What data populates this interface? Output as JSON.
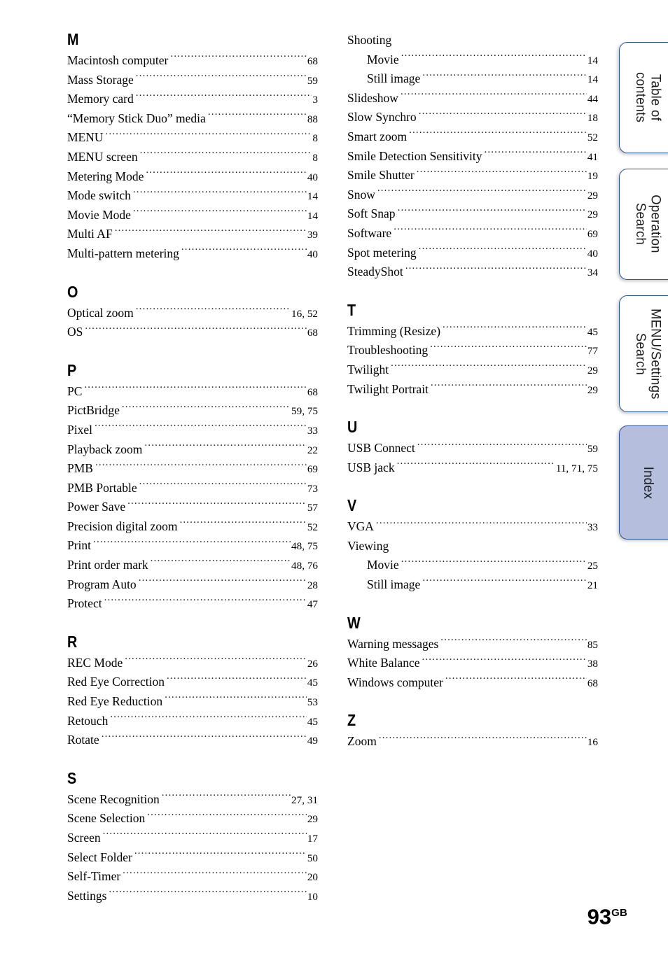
{
  "document": {
    "page_number": "93",
    "page_number_suffix": "GB"
  },
  "side_tabs": [
    {
      "label": "Table of\ncontents",
      "active": false
    },
    {
      "label": "Operation\nSearch",
      "active": false
    },
    {
      "label": "MENU/Settings\nSearch",
      "active": false
    },
    {
      "label": "Index",
      "active": true
    }
  ],
  "columns": [
    {
      "blocks": [
        {
          "letter": "M",
          "entries": [
            {
              "label": "Macintosh computer",
              "page": "68"
            },
            {
              "label": "Mass Storage",
              "page": "59"
            },
            {
              "label": "Memory card",
              "page": "3"
            },
            {
              "label": "“Memory Stick Duo” media",
              "page": "88"
            },
            {
              "label": "MENU",
              "page": "8"
            },
            {
              "label": "MENU screen",
              "page": "8"
            },
            {
              "label": "Metering Mode",
              "page": "40"
            },
            {
              "label": "Mode switch",
              "page": "14"
            },
            {
              "label": "Movie Mode",
              "page": "14"
            },
            {
              "label": "Multi AF",
              "page": "39"
            },
            {
              "label": "Multi-pattern metering",
              "page": "40"
            }
          ]
        },
        {
          "letter": "O",
          "entries": [
            {
              "label": "Optical zoom",
              "page": "16, 52"
            },
            {
              "label": "OS",
              "page": "68"
            }
          ]
        },
        {
          "letter": "P",
          "entries": [
            {
              "label": "PC",
              "page": "68"
            },
            {
              "label": "PictBridge",
              "page": "59, 75"
            },
            {
              "label": "Pixel",
              "page": "33"
            },
            {
              "label": "Playback zoom",
              "page": "22"
            },
            {
              "label": "PMB",
              "page": "69"
            },
            {
              "label": "PMB Portable",
              "page": "73"
            },
            {
              "label": "Power Save",
              "page": "57"
            },
            {
              "label": "Precision digital zoom",
              "page": "52"
            },
            {
              "label": "Print",
              "page": "48, 75"
            },
            {
              "label": "Print order mark",
              "page": "48, 76"
            },
            {
              "label": "Program Auto",
              "page": "28"
            },
            {
              "label": "Protect",
              "page": "47"
            }
          ]
        },
        {
          "letter": "R",
          "entries": [
            {
              "label": "REC Mode",
              "page": "26"
            },
            {
              "label": "Red Eye Correction",
              "page": "45"
            },
            {
              "label": "Red Eye Reduction",
              "page": "53"
            },
            {
              "label": "Retouch",
              "page": "45"
            },
            {
              "label": "Rotate",
              "page": "49"
            }
          ]
        },
        {
          "letter": "S",
          "entries": [
            {
              "label": "Scene Recognition",
              "page": "27, 31"
            },
            {
              "label": "Scene Selection",
              "page": "29"
            },
            {
              "label": "Screen",
              "page": "17"
            },
            {
              "label": "Select Folder",
              "page": "50"
            },
            {
              "label": "Self-Timer",
              "page": "20"
            },
            {
              "label": "Settings",
              "page": "10"
            }
          ]
        }
      ]
    },
    {
      "blocks": [
        {
          "letter": "",
          "entries": [
            {
              "label": "Shooting",
              "page": ""
            },
            {
              "label": "Movie",
              "page": "14",
              "sub": true
            },
            {
              "label": "Still image",
              "page": "14",
              "sub": true
            },
            {
              "label": "Slideshow",
              "page": "44"
            },
            {
              "label": "Slow Synchro",
              "page": "18"
            },
            {
              "label": "Smart zoom",
              "page": "52"
            },
            {
              "label": "Smile Detection Sensitivity",
              "page": "41"
            },
            {
              "label": "Smile Shutter",
              "page": "19"
            },
            {
              "label": "Snow",
              "page": "29"
            },
            {
              "label": "Soft Snap",
              "page": "29"
            },
            {
              "label": "Software",
              "page": "69"
            },
            {
              "label": "Spot metering",
              "page": "40"
            },
            {
              "label": "SteadyShot",
              "page": "34"
            }
          ]
        },
        {
          "letter": "T",
          "entries": [
            {
              "label": "Trimming (Resize)",
              "page": "45"
            },
            {
              "label": "Troubleshooting",
              "page": "77"
            },
            {
              "label": "Twilight",
              "page": "29"
            },
            {
              "label": "Twilight Portrait",
              "page": "29"
            }
          ]
        },
        {
          "letter": "U",
          "entries": [
            {
              "label": "USB Connect",
              "page": "59"
            },
            {
              "label": "USB jack",
              "page": "11, 71, 75"
            }
          ]
        },
        {
          "letter": "V",
          "entries": [
            {
              "label": "VGA",
              "page": "33"
            },
            {
              "label": "Viewing",
              "page": ""
            },
            {
              "label": "Movie",
              "page": "25",
              "sub": true
            },
            {
              "label": "Still image",
              "page": "21",
              "sub": true
            }
          ]
        },
        {
          "letter": "W",
          "entries": [
            {
              "label": "Warning messages",
              "page": "85"
            },
            {
              "label": "White Balance",
              "page": "38"
            },
            {
              "label": "Windows computer",
              "page": "68"
            }
          ]
        },
        {
          "letter": "Z",
          "entries": [
            {
              "label": "Zoom",
              "page": "16"
            }
          ]
        }
      ]
    }
  ],
  "colors": {
    "tab_border": "#2a5699",
    "tab_active_fill": "#b5bedd",
    "page_background": "#ffffff",
    "text": "#000000"
  }
}
